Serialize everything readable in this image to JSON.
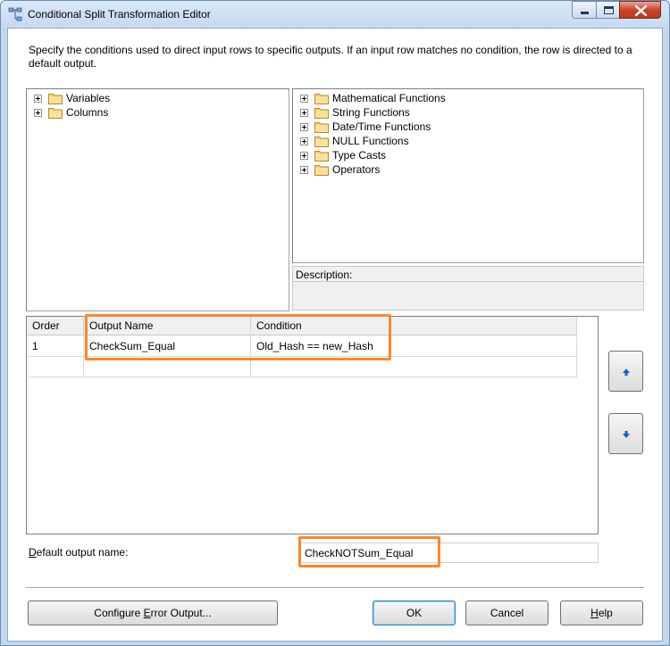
{
  "window": {
    "title": "Conditional Split Transformation Editor"
  },
  "instruction": "Specify the conditions used to direct input rows to specific outputs. If an input row matches no condition, the row is directed to a default output.",
  "left_tree": {
    "items": [
      {
        "label": "Variables"
      },
      {
        "label": "Columns"
      }
    ]
  },
  "right_tree": {
    "items": [
      {
        "label": "Mathematical Functions"
      },
      {
        "label": "String Functions"
      },
      {
        "label": "Date/Time Functions"
      },
      {
        "label": "NULL Functions"
      },
      {
        "label": "Type Casts"
      },
      {
        "label": "Operators"
      }
    ]
  },
  "description": {
    "label": "Description:"
  },
  "grid": {
    "columns": [
      "Order",
      "Output Name",
      "Condition"
    ],
    "rows": [
      {
        "order": "1",
        "output_name": "CheckSum_Equal",
        "condition": "Old_Hash == new_Hash"
      }
    ]
  },
  "default_output": {
    "label": "Default output name:",
    "value": "CheckNOTSum_Equal"
  },
  "buttons": {
    "configure_error": {
      "pre": "Configure ",
      "accel": "E",
      "post": "rror Output..."
    },
    "ok": "OK",
    "cancel": "Cancel",
    "help": {
      "accel": "H",
      "post": "elp"
    }
  },
  "colors": {
    "highlight": "#f7882f",
    "window_frame": "#c4d6ec"
  }
}
